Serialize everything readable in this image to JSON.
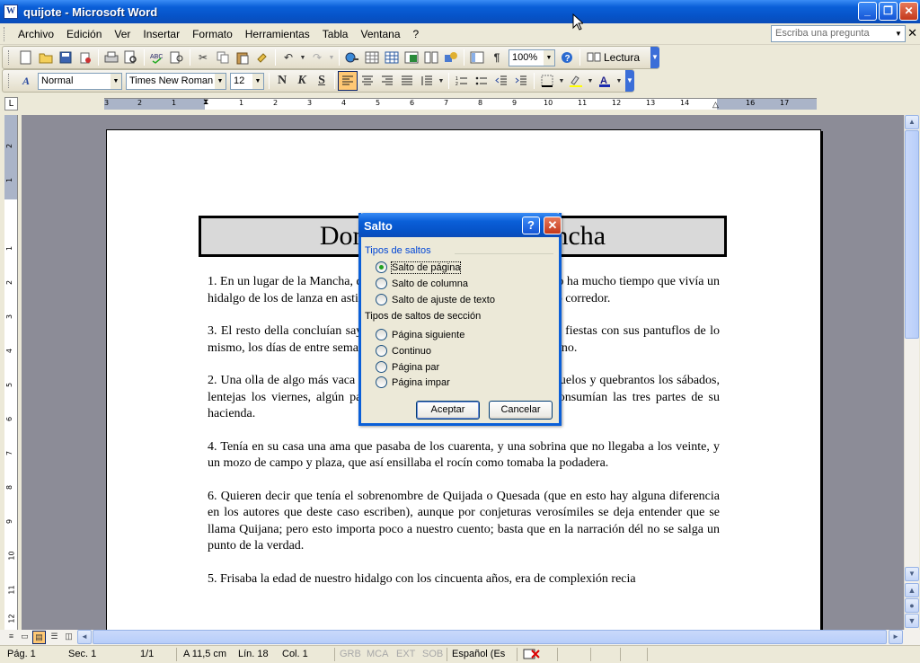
{
  "window": {
    "title": "quijote - Microsoft Word",
    "app_icon": "W",
    "minimize": "_",
    "maximize": "❐",
    "close": "✕"
  },
  "menu": {
    "items": [
      "Archivo",
      "Edición",
      "Ver",
      "Insertar",
      "Formato",
      "Herramientas",
      "Tabla",
      "Ventana",
      "?"
    ],
    "ask_placeholder": "Escriba una pregunta",
    "close_doc": "✕"
  },
  "standard_toolbar": {
    "zoom": "100%",
    "reading_label": "Lectura"
  },
  "format_toolbar": {
    "style": "Normal",
    "font": "Times New Roman",
    "size": "12",
    "bold": "N",
    "italic": "K",
    "strike": "S"
  },
  "ruler": {
    "h_ticks": [
      "3",
      "2",
      "1",
      "1",
      "2",
      "3",
      "4",
      "5",
      "6",
      "7",
      "8",
      "9",
      "10",
      "11",
      "12",
      "13",
      "14",
      "15",
      "16",
      "17"
    ],
    "v_ticks": [
      "2",
      "1",
      "1",
      "2",
      "3",
      "4",
      "5",
      "6",
      "7",
      "8",
      "9",
      "10",
      "11",
      "12"
    ]
  },
  "document": {
    "title": "Don Quijote de la Mancha",
    "paragraphs": [
      "1. En un lugar de la Mancha, de cuyo nombre no quiero acordarme, no ha mucho tiempo que vivía un hidalgo de los de lanza en astillero, adarga antigua, rocín flaco y galgo corredor.",
      "3. El resto della concluían sayo de velarte, calzas de velludo para las fiestas con sus pantuflos de lo mismo, los días de entre semana se honraba con su vellori de lo más fino.",
      "2. Una olla de algo más vaca que carnero, salpicón las más noches, duelos y quebrantos los sábados, lentejas los viernes, algún palomino de añadidura los domingos, consumían las tres partes de su hacienda.",
      "4. Tenía en su casa una ama que pasaba de los cuarenta, y una sobrina que no llegaba a los veinte, y un mozo de campo y plaza, que así ensillaba el rocín como tomaba la podadera.",
      "6. Quieren decir que tenía el sobrenombre de Quijada o Quesada (que en esto hay alguna diferencia en los autores que deste caso escriben), aunque por conjeturas verosímiles se deja entender que se llama Quijana; pero esto importa poco a nuestro cuento; basta que en la narración dél no se salga un punto de la verdad.",
      "5. Frisaba la edad de nuestro hidalgo con los cincuenta años, era de complexión recia"
    ]
  },
  "dialog": {
    "title": "Salto",
    "help": "?",
    "close": "✕",
    "group_breaks": "Tipos de saltos",
    "options_breaks": [
      "Salto de página",
      "Salto de columna",
      "Salto de ajuste de texto"
    ],
    "group_sections": "Tipos de saltos de sección",
    "options_sections": [
      "Página siguiente",
      "Continuo",
      "Página par",
      "Página impar"
    ],
    "selected": "Salto de página",
    "ok": "Aceptar",
    "cancel": "Cancelar"
  },
  "status": {
    "page": "Pág. 1",
    "section": "Sec. 1",
    "pages": "1/1",
    "at": "A 11,5 cm",
    "line": "Lín. 18",
    "col": "Col. 1",
    "grb": "GRB",
    "mca": "MCA",
    "ext": "EXT",
    "sob": "SOB",
    "language": "Español (Es"
  }
}
